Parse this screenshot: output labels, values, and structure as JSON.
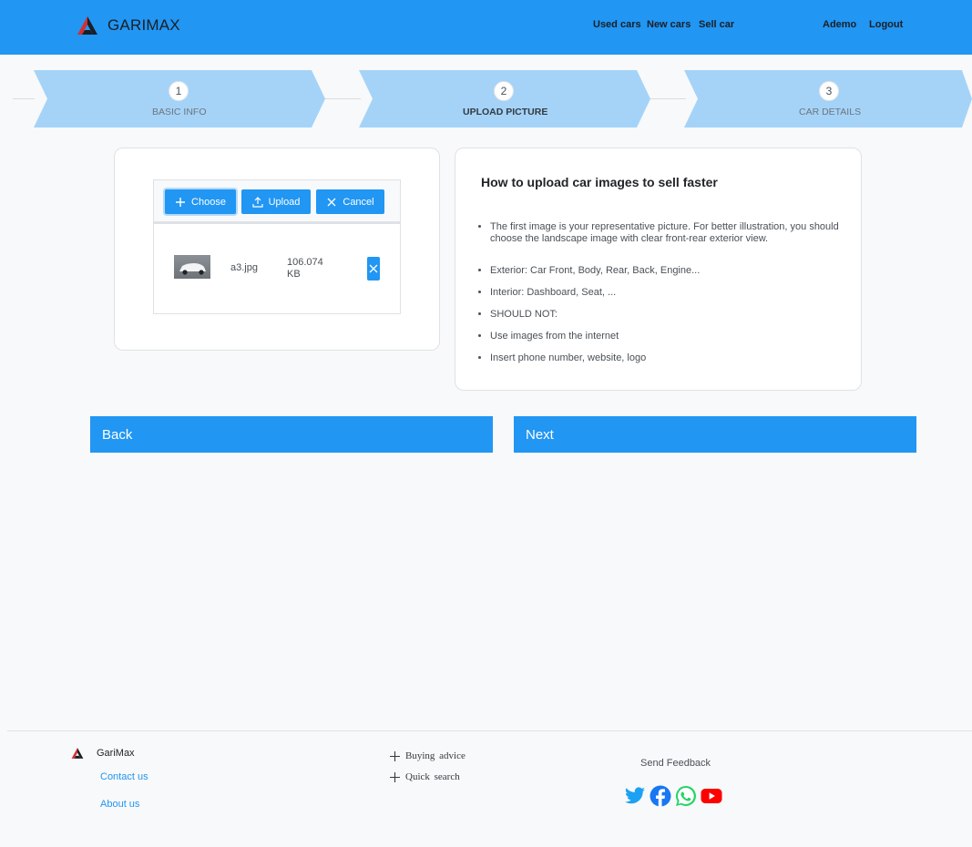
{
  "header": {
    "brand": "GARIMAX",
    "nav": [
      "Used cars",
      "New cars",
      "Sell car",
      "Ademo",
      "Logout"
    ]
  },
  "steps": [
    {
      "num": "1",
      "label": "BASIC INFO"
    },
    {
      "num": "2",
      "label": "UPLOAD PICTURE"
    },
    {
      "num": "3",
      "label": "CAR DETAILS"
    }
  ],
  "upload": {
    "choose": "Choose",
    "upload": "Upload",
    "cancel": "Cancel",
    "file_name": "a3.jpg",
    "file_size": "106.074 KB"
  },
  "help": {
    "title": "How to upload car images to sell faster",
    "items": [
      "The first image is your representative picture. For better illustration, you should choose the landscape image with clear front-rear exterior view.",
      "Exterior: Car Front, Body, Rear, Back, Engine...",
      "Interior: Dashboard, Seat, ...",
      "SHOULD NOT:",
      "Use images from the internet",
      "Insert phone number, website, logo"
    ]
  },
  "actions": {
    "back": "Back",
    "next": "Next"
  },
  "footer": {
    "brand": "GariMax",
    "contact": "Contact us",
    "about": "About us",
    "buying": "Buying advice",
    "quick": "Quick search",
    "feedback": "Send Feedback"
  },
  "colors": {
    "primary": "#2196f3",
    "step_fill": "#a5d3f8",
    "twitter": "#1da1f2",
    "facebook": "#1877f2",
    "whatsapp": "#25d366",
    "youtube": "#ff0000"
  },
  "icons": [
    "garimax-logo-icon",
    "plus-icon",
    "upload-icon",
    "close-icon",
    "twitter-icon",
    "facebook-icon",
    "whatsapp-icon",
    "youtube-icon"
  ]
}
